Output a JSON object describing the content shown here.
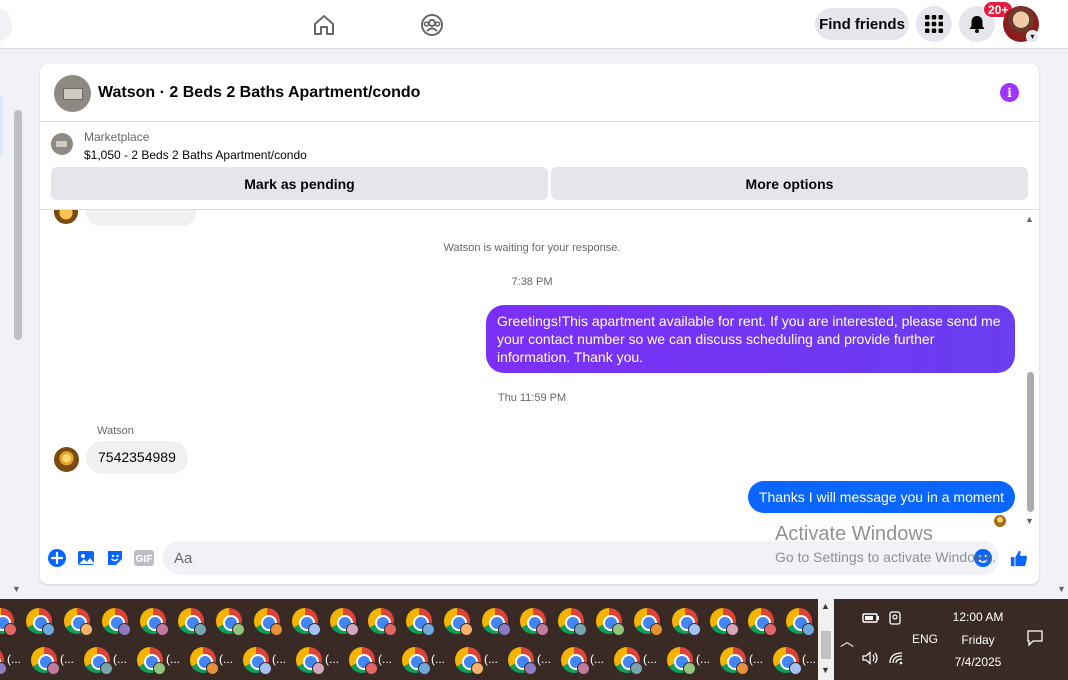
{
  "topbar": {
    "find_friends_label": "Find friends",
    "notification_count": "20+",
    "icons": [
      "home-icon",
      "groups-icon",
      "menu-grid-icon",
      "bell-icon",
      "avatar",
      "chevron-down-icon"
    ]
  },
  "chat": {
    "title": "Watson · 2 Beds 2 Baths Apartment/condo",
    "listing": {
      "source": "Marketplace",
      "description": "$1,050 - 2 Beds 2 Baths Apartment/condo"
    },
    "actions": {
      "mark_pending": "Mark as pending",
      "more_options": "More options"
    },
    "messages": {
      "waiting_notice": "Watson is waiting for your response.",
      "time_1": "7:38 PM",
      "outgoing_1": "Greetings!This  apartment available for rent. If you are interested, please send me your contact number so we can discuss scheduling and provide further information. Thank you.",
      "time_2": "Thu 11:59 PM",
      "sender": "Watson",
      "incoming_1": "7542354989",
      "outgoing_2": "Thanks I will message you in a moment"
    },
    "composer": {
      "placeholder": "Aa",
      "gif_label": "GIF"
    }
  },
  "watermark": {
    "title": "Activate Windows",
    "subtitle": "Go to Settings to activate Windows."
  },
  "taskbar": {
    "ellipsis": "(...",
    "language": "ENG",
    "time": "12:00 AM",
    "day": "Friday",
    "date": "7/4/2025"
  },
  "colors": {
    "accent_purple": "#7b2ff7",
    "accent_blue": "#0a66ff",
    "messenger_blue": "#0866ff",
    "info_purple": "#a033ff",
    "badge_red": "#e41e3f"
  }
}
